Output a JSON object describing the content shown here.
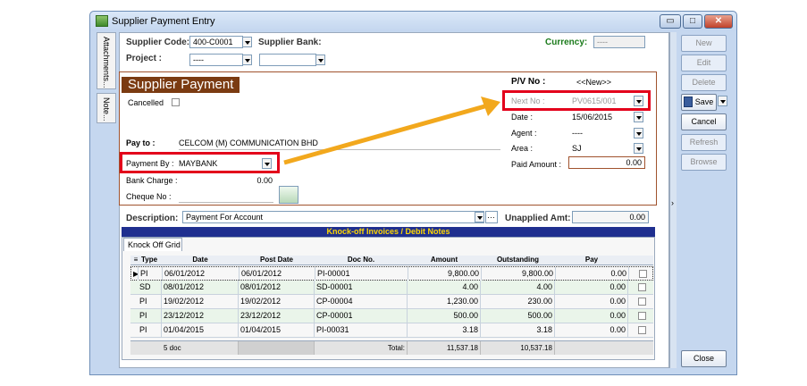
{
  "window": {
    "title": "Supplier Payment Entry",
    "btn_min": "▭",
    "btn_max": "□",
    "btn_close": "✕"
  },
  "sidetabs": {
    "attachments": "Attachments...",
    "note": "Note..."
  },
  "header": {
    "supplier_code_label": "Supplier Code:",
    "supplier_code": "400-C0001",
    "supplier_bank_label": "Supplier Bank:",
    "supplier_bank": "",
    "project_label": "Project :",
    "project": "----",
    "currency_label": "Currency:",
    "currency": "----"
  },
  "form": {
    "title": "Supplier Payment",
    "cancelled_label": "Cancelled",
    "pay_to_label": "Pay to :",
    "pay_to": "CELCOM (M) COMMUNICATION BHD",
    "payment_by_label": "Payment By :",
    "payment_by": "MAYBANK",
    "bank_charge_label": "Bank Charge :",
    "bank_charge": "0.00",
    "cheque_no_label": "Cheque No :",
    "cheque_no": "",
    "pv_no_label": "P/V No :",
    "pv_no": "<<New>>",
    "next_no_label": "Next No :",
    "next_no": "PV0615/001",
    "date_label": "Date :",
    "date": "15/06/2015",
    "agent_label": "Agent :",
    "agent": "----",
    "area_label": "Area :",
    "area": "SJ",
    "paid_amount_label": "Paid Amount :",
    "paid_amount": "0.00",
    "description_label": "Description:",
    "description": "Payment For Account",
    "description_more": "···",
    "unapplied_label": "Unapplied Amt:",
    "unapplied": "0.00"
  },
  "knockoff": {
    "banner": "Knock-off Invoices / Debit Notes",
    "tab": "Knock Off Grid",
    "columns": [
      "Type",
      "Date",
      "Post Date",
      "Doc No.",
      "Amount",
      "Outstanding",
      "Pay"
    ],
    "rows": [
      {
        "type": "PI",
        "date": "06/01/2012",
        "post_date": "06/01/2012",
        "doc_no": "PI-00001",
        "amount": "9,800.00",
        "outstanding": "9,800.00",
        "pay": "0.00"
      },
      {
        "type": "SD",
        "date": "08/01/2012",
        "post_date": "08/01/2012",
        "doc_no": "SD-00001",
        "amount": "4.00",
        "outstanding": "4.00",
        "pay": "0.00"
      },
      {
        "type": "PI",
        "date": "19/02/2012",
        "post_date": "19/02/2012",
        "doc_no": "CP-00004",
        "amount": "1,230.00",
        "outstanding": "230.00",
        "pay": "0.00"
      },
      {
        "type": "PI",
        "date": "23/12/2012",
        "post_date": "23/12/2012",
        "doc_no": "CP-00001",
        "amount": "500.00",
        "outstanding": "500.00",
        "pay": "0.00"
      },
      {
        "type": "PI",
        "date": "01/04/2015",
        "post_date": "01/04/2015",
        "doc_no": "PI-00031",
        "amount": "3.18",
        "outstanding": "3.18",
        "pay": "0.00"
      }
    ],
    "footer": {
      "count": "5 doc",
      "total_label": "Total:",
      "total_amount": "11,537.18",
      "total_outstanding": "10,537.18"
    }
  },
  "buttons": {
    "new": "New",
    "edit": "Edit",
    "delete": "Delete",
    "save": "Save",
    "cancel": "Cancel",
    "refresh": "Refresh",
    "browse": "Browse",
    "close": "Close"
  },
  "colors": {
    "accent_red": "#e3001b",
    "arrow": "#f2a81d",
    "title_bar": "#7b3b12",
    "banner": "#1f2f8f",
    "banner_text": "#ffd800"
  }
}
